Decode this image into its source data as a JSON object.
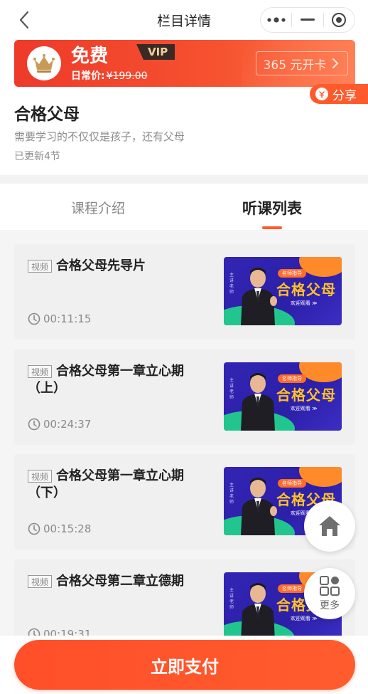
{
  "topbar": {
    "title": "栏目详情",
    "back_icon": "chevron-left-icon",
    "more_icon": "more-dots-icon",
    "minimize_icon": "minimize-icon",
    "close_icon": "target-close-icon"
  },
  "vip_banner": {
    "free_label": "免费",
    "vip_tag": "VIP",
    "daily_price_label": "日常价:",
    "daily_price_value": "¥199.00",
    "open_card_label": "365 元开卡",
    "crown_icon": "crown-icon",
    "arrow_icon": "chevron-right-icon"
  },
  "share": {
    "label": "分享",
    "icon": "share-money-icon"
  },
  "course": {
    "title": "合格父母",
    "description": "需要学习的不仅仅是孩子，还有父母",
    "updated": "已更新4节"
  },
  "tabs": [
    {
      "label": "课程介绍",
      "active": false
    },
    {
      "label": "听课列表",
      "active": true
    }
  ],
  "lessons": [
    {
      "tag": "视频",
      "title": "合格父母先导片",
      "duration": "00:11:15"
    },
    {
      "tag": "视频",
      "title": "合格父母第一章立心期（上）",
      "duration": "00:24:37"
    },
    {
      "tag": "视频",
      "title": "合格父母第一章立心期（下）",
      "duration": "00:15:28"
    },
    {
      "tag": "视频",
      "title": "合格父母第二章立德期",
      "duration": "00:19:31"
    }
  ],
  "thumbnail": {
    "badge": "名师指导",
    "headline": "合格父母",
    "welcome": "欢迎观看 ≫",
    "side_text": "主讲 老师"
  },
  "floating": {
    "home_icon": "home-icon",
    "more_icon": "grid-more-icon",
    "more_label": "更多"
  },
  "pay": {
    "label": "立即支付"
  },
  "colors": {
    "accent": "#ff5a2c",
    "banner_start": "#ee3a2a",
    "banner_end": "#ff6d3d",
    "text_primary": "#222222",
    "text_secondary": "#8c8c8c"
  }
}
